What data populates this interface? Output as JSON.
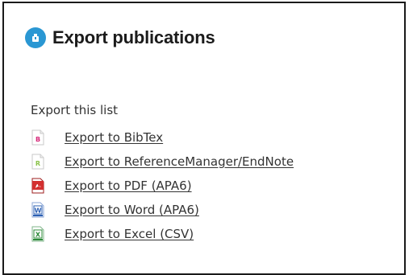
{
  "header": {
    "title": "Export publications",
    "icon": "export-icon",
    "icon_color": "#2a97d3"
  },
  "section": {
    "label": "Export this list"
  },
  "exports": [
    {
      "label": "Export to BibTex",
      "icon": "bibtex-file-icon",
      "icon_letter": "B",
      "color": "#d6287a"
    },
    {
      "label": "Export to ReferenceManager/EndNote",
      "icon": "refman-file-icon",
      "icon_letter": "R",
      "color": "#8bc34a"
    },
    {
      "label": "Export to PDF (APA6)",
      "icon": "pdf-file-icon",
      "color": "#d32f2f"
    },
    {
      "label": "Export to Word (APA6)",
      "icon": "word-file-icon",
      "icon_letter": "W",
      "color": "#2b5fb3"
    },
    {
      "label": "Export to Excel (CSV)",
      "icon": "excel-file-icon",
      "icon_letter": "X",
      "color": "#2e8b3a"
    }
  ]
}
